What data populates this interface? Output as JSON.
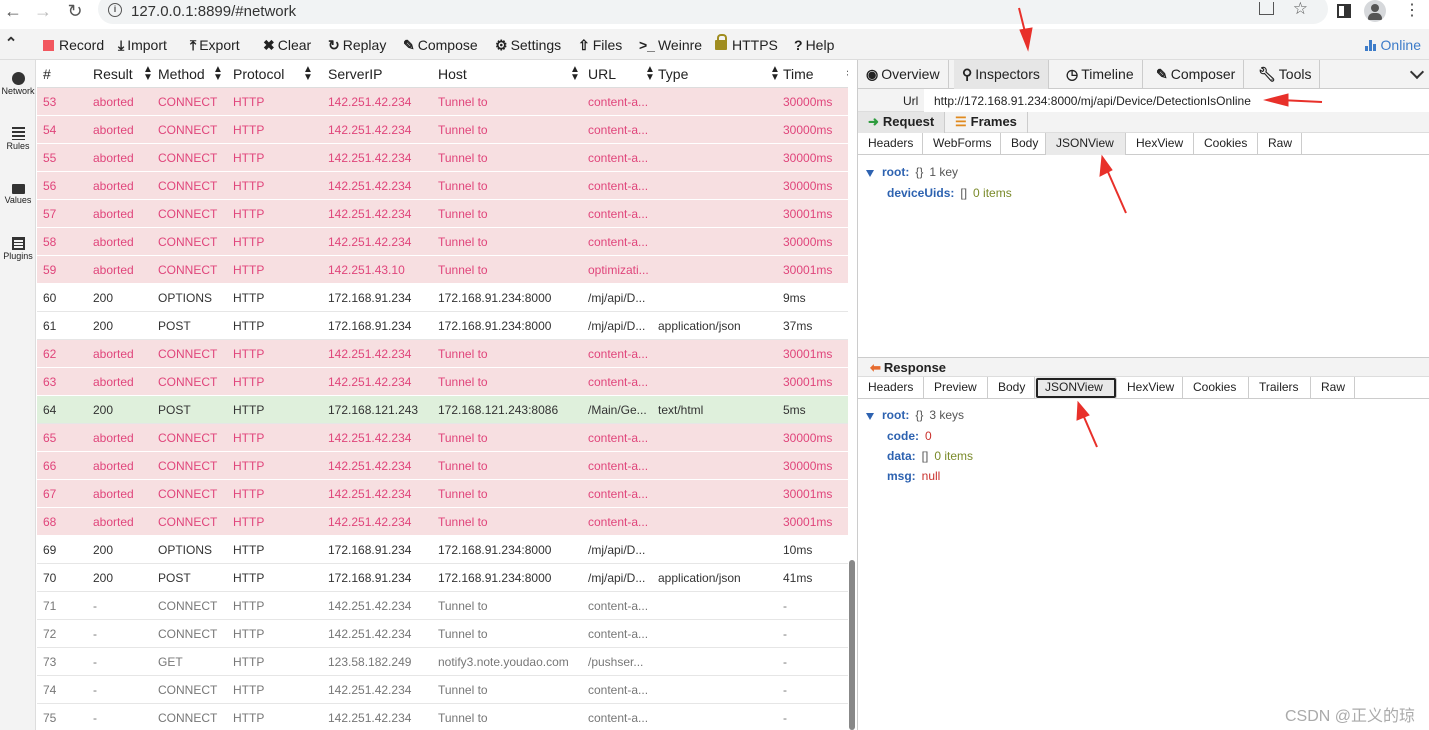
{
  "browser": {
    "url": "127.0.0.1:8899/#network"
  },
  "toolbar": {
    "items": [
      "Record",
      "Import",
      "Export",
      "Clear",
      "Replay",
      "Compose",
      "Settings",
      "Files",
      "Weinre",
      "HTTPS",
      "Help"
    ],
    "status": "Online"
  },
  "left_nav": {
    "items": [
      "Network",
      "Rules",
      "Values",
      "Plugins"
    ]
  },
  "table": {
    "columns": [
      "#",
      "Result",
      "Method",
      "Protocol",
      "ServerIP",
      "Host",
      "URL",
      "Type",
      "Time"
    ],
    "rows": [
      {
        "id": "53",
        "result": "aborted",
        "method": "CONNECT",
        "protocol": "HTTP",
        "ip": "142.251.42.234",
        "host": "Tunnel to",
        "url": "content-a...",
        "type": "",
        "time": "30000ms",
        "status": "err"
      },
      {
        "id": "54",
        "result": "aborted",
        "method": "CONNECT",
        "protocol": "HTTP",
        "ip": "142.251.42.234",
        "host": "Tunnel to",
        "url": "content-a...",
        "type": "",
        "time": "30000ms",
        "status": "err"
      },
      {
        "id": "55",
        "result": "aborted",
        "method": "CONNECT",
        "protocol": "HTTP",
        "ip": "142.251.42.234",
        "host": "Tunnel to",
        "url": "content-a...",
        "type": "",
        "time": "30000ms",
        "status": "err"
      },
      {
        "id": "56",
        "result": "aborted",
        "method": "CONNECT",
        "protocol": "HTTP",
        "ip": "142.251.42.234",
        "host": "Tunnel to",
        "url": "content-a...",
        "type": "",
        "time": "30000ms",
        "status": "err"
      },
      {
        "id": "57",
        "result": "aborted",
        "method": "CONNECT",
        "protocol": "HTTP",
        "ip": "142.251.42.234",
        "host": "Tunnel to",
        "url": "content-a...",
        "type": "",
        "time": "30001ms",
        "status": "err"
      },
      {
        "id": "58",
        "result": "aborted",
        "method": "CONNECT",
        "protocol": "HTTP",
        "ip": "142.251.42.234",
        "host": "Tunnel to",
        "url": "content-a...",
        "type": "",
        "time": "30000ms",
        "status": "err"
      },
      {
        "id": "59",
        "result": "aborted",
        "method": "CONNECT",
        "protocol": "HTTP",
        "ip": "142.251.43.10",
        "host": "Tunnel to",
        "url": "optimizati...",
        "type": "",
        "time": "30001ms",
        "status": "err"
      },
      {
        "id": "60",
        "result": "200",
        "method": "OPTIONS",
        "protocol": "HTTP",
        "ip": "172.168.91.234",
        "host": "172.168.91.234:8000",
        "url": "/mj/api/D...",
        "type": "",
        "time": "9ms",
        "status": "ok"
      },
      {
        "id": "61",
        "result": "200",
        "method": "POST",
        "protocol": "HTTP",
        "ip": "172.168.91.234",
        "host": "172.168.91.234:8000",
        "url": "/mj/api/D...",
        "type": "application/json",
        "time": "37ms",
        "status": "ok"
      },
      {
        "id": "62",
        "result": "aborted",
        "method": "CONNECT",
        "protocol": "HTTP",
        "ip": "142.251.42.234",
        "host": "Tunnel to",
        "url": "content-a...",
        "type": "",
        "time": "30001ms",
        "status": "err"
      },
      {
        "id": "63",
        "result": "aborted",
        "method": "CONNECT",
        "protocol": "HTTP",
        "ip": "142.251.42.234",
        "host": "Tunnel to",
        "url": "content-a...",
        "type": "",
        "time": "30001ms",
        "status": "err"
      },
      {
        "id": "64",
        "result": "200",
        "method": "POST",
        "protocol": "HTTP",
        "ip": "172.168.121.243",
        "host": "172.168.121.243:8086",
        "url": "/Main/Ge...",
        "type": "text/html",
        "time": "5ms",
        "status": "hl"
      },
      {
        "id": "65",
        "result": "aborted",
        "method": "CONNECT",
        "protocol": "HTTP",
        "ip": "142.251.42.234",
        "host": "Tunnel to",
        "url": "content-a...",
        "type": "",
        "time": "30000ms",
        "status": "err"
      },
      {
        "id": "66",
        "result": "aborted",
        "method": "CONNECT",
        "protocol": "HTTP",
        "ip": "142.251.42.234",
        "host": "Tunnel to",
        "url": "content-a...",
        "type": "",
        "time": "30000ms",
        "status": "err"
      },
      {
        "id": "67",
        "result": "aborted",
        "method": "CONNECT",
        "protocol": "HTTP",
        "ip": "142.251.42.234",
        "host": "Tunnel to",
        "url": "content-a...",
        "type": "",
        "time": "30001ms",
        "status": "err"
      },
      {
        "id": "68",
        "result": "aborted",
        "method": "CONNECT",
        "protocol": "HTTP",
        "ip": "142.251.42.234",
        "host": "Tunnel to",
        "url": "content-a...",
        "type": "",
        "time": "30001ms",
        "status": "err"
      },
      {
        "id": "69",
        "result": "200",
        "method": "OPTIONS",
        "protocol": "HTTP",
        "ip": "172.168.91.234",
        "host": "172.168.91.234:8000",
        "url": "/mj/api/D...",
        "type": "",
        "time": "10ms",
        "status": "ok"
      },
      {
        "id": "70",
        "result": "200",
        "method": "POST",
        "protocol": "HTTP",
        "ip": "172.168.91.234",
        "host": "172.168.91.234:8000",
        "url": "/mj/api/D...",
        "type": "application/json",
        "time": "41ms",
        "status": "ok"
      },
      {
        "id": "71",
        "result": "-",
        "method": "CONNECT",
        "protocol": "HTTP",
        "ip": "142.251.42.234",
        "host": "Tunnel to",
        "url": "content-a...",
        "type": "",
        "time": "-",
        "status": "pend"
      },
      {
        "id": "72",
        "result": "-",
        "method": "CONNECT",
        "protocol": "HTTP",
        "ip": "142.251.42.234",
        "host": "Tunnel to",
        "url": "content-a...",
        "type": "",
        "time": "-",
        "status": "pend"
      },
      {
        "id": "73",
        "result": "-",
        "method": "GET",
        "protocol": "HTTP",
        "ip": "123.58.182.249",
        "host": "notify3.note.youdao.com",
        "url": "/pushser...",
        "type": "",
        "time": "-",
        "status": "pend"
      },
      {
        "id": "74",
        "result": "-",
        "method": "CONNECT",
        "protocol": "HTTP",
        "ip": "142.251.42.234",
        "host": "Tunnel to",
        "url": "content-a...",
        "type": "",
        "time": "-",
        "status": "pend"
      },
      {
        "id": "75",
        "result": "-",
        "method": "CONNECT",
        "protocol": "HTTP",
        "ip": "142.251.42.234",
        "host": "Tunnel to",
        "url": "content-a...",
        "type": "",
        "time": "-",
        "status": "pend"
      }
    ]
  },
  "right": {
    "tabs": [
      "Overview",
      "Inspectors",
      "Timeline",
      "Composer",
      "Tools"
    ],
    "url_label": "Url",
    "url_value": "http://172.168.91.234:8000/mj/api/Device/DetectionIsOnline",
    "request_label": "Request",
    "frames_label": "Frames",
    "request_tabs": [
      "Headers",
      "WebForms",
      "Body",
      "JSONView",
      "HexView",
      "Cookies",
      "Raw"
    ],
    "request_json": {
      "root_key": "root:",
      "root_brace": "{}",
      "root_meta": "1 key",
      "child_key": "deviceUids:",
      "child_brace": "[]",
      "child_meta": "0 items"
    },
    "response_label": "Response",
    "response_tabs": [
      "Headers",
      "Preview",
      "Body",
      "JSONView",
      "HexView",
      "Cookies",
      "Trailers",
      "Raw"
    ],
    "response_json": {
      "root_key": "root:",
      "root_brace": "{}",
      "root_meta": "3 keys",
      "code_key": "code:",
      "code_val": "0",
      "data_key": "data:",
      "data_brace": "[]",
      "data_meta": "0 items",
      "msg_key": "msg:",
      "msg_val": "null"
    }
  },
  "watermark": "CSDN @正义的琼",
  "colors": {
    "error_row": "#f7dfe1",
    "error_text": "#e0457b",
    "highlight_row": "#dff0dc",
    "accent": "#3d7cc9",
    "annotation_arrow": "#e8302a"
  }
}
